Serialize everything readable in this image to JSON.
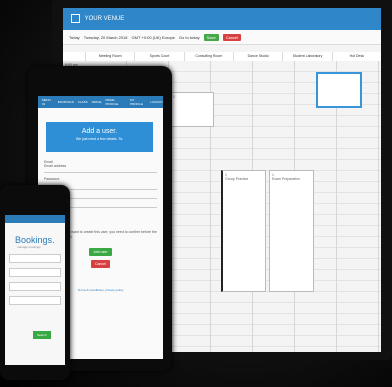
{
  "laptop": {
    "app_title": "YOUR VENUE",
    "toolbar": {
      "date_text": "Tuesday, 20 March 2018",
      "timezone_text": "GMT +0:00 (UK) Europe",
      "goto_text": "Go to today",
      "today_label": "Today",
      "search_label": "Go",
      "save_label": "Save",
      "cancel_label": "Cancel"
    },
    "columns": [
      "",
      "Meeting Room",
      "Sports Court",
      "Consulting Room",
      "Dance Studio",
      "Student Laboratory",
      "Hot Desk"
    ],
    "time_label": "9:00 am",
    "blocks": [
      {
        "label": "1",
        "text": ""
      },
      {
        "label": "1",
        "text": "Group Practice"
      },
      {
        "label": "1",
        "text": "Exam Preparation"
      },
      {
        "label": "",
        "text": ""
      }
    ]
  },
  "tablet": {
    "nav_items": [
      "MENU 01",
      "BOOKINGS",
      "CLASS",
      "SPACE",
      "MORE PROFILE",
      "MY PROFILE",
      "LOGOUT"
    ],
    "hero_title": "Add a user.",
    "hero_subtitle": "We just need a few details. Ta.",
    "form": {
      "email_label": "Email",
      "email_placeholder": "Email address",
      "password_label": "Password",
      "note_text": "Are you sure you want to create this user, you need to confirm before the page is submitted."
    },
    "add_button": "Add user",
    "cancel_button": "Cancel",
    "footer": "Terms & Conditions, privacy policy"
  },
  "phone": {
    "title": "Bookings.",
    "subtitle": "manage bookings",
    "button": "Search"
  }
}
